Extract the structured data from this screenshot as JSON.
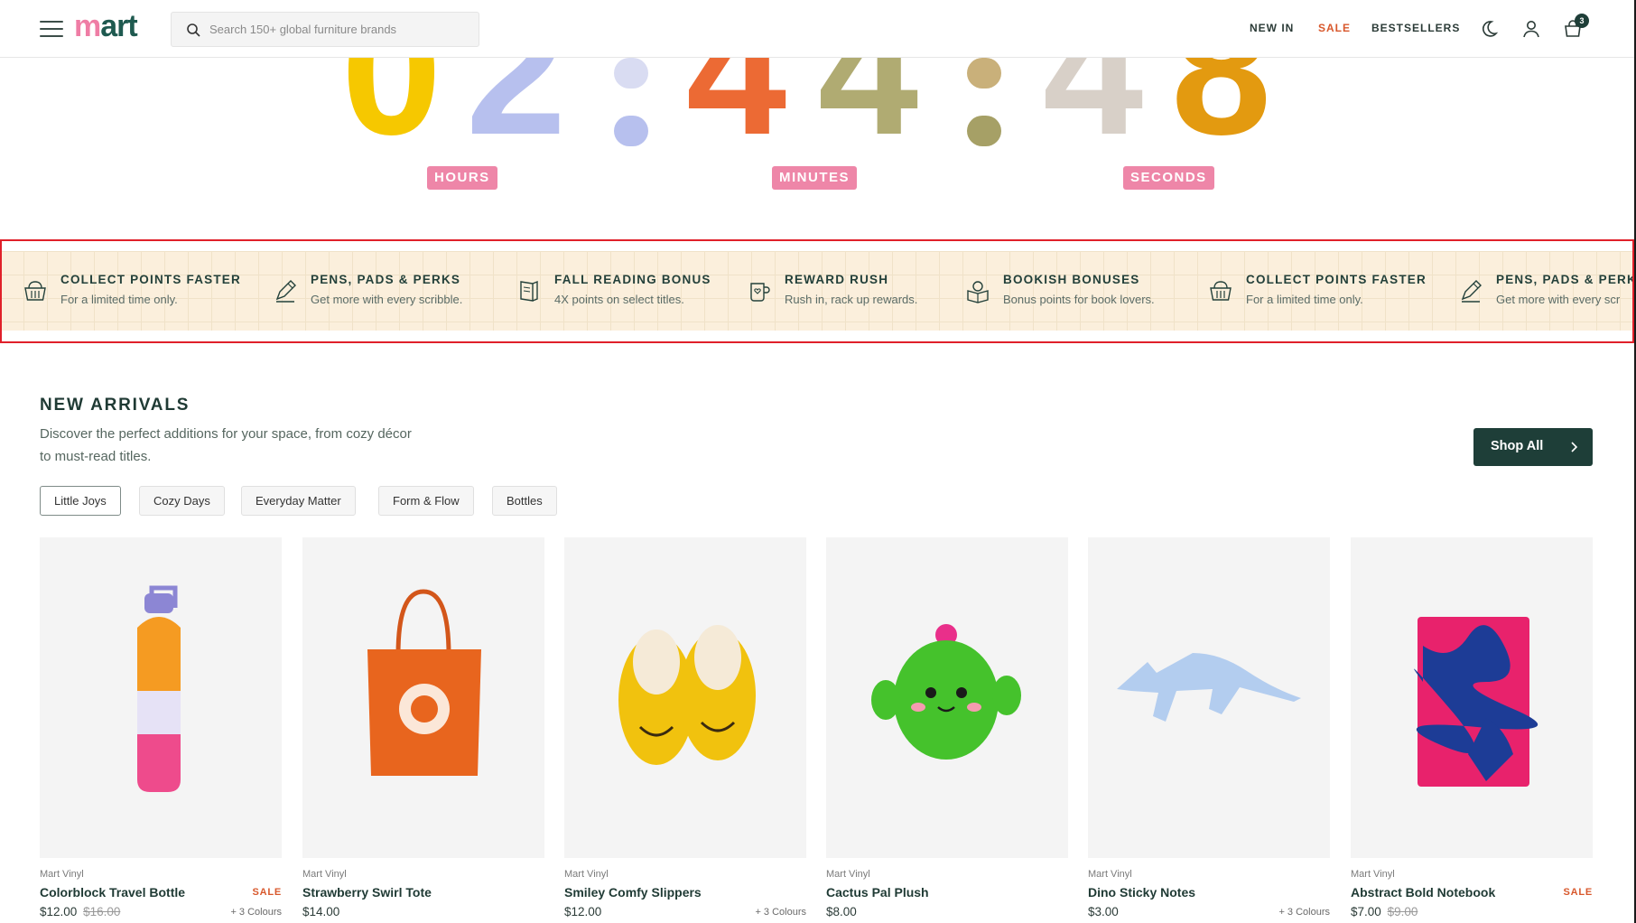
{
  "header": {
    "logo": {
      "part1": "m",
      "part2": "art"
    },
    "search": {
      "placeholder": "Search 150+ global furniture brands",
      "value": ""
    },
    "nav": [
      "NEW IN",
      "SALE",
      "BESTSELLERS"
    ],
    "cart_count": "3",
    "accent_sale": "#d8582c"
  },
  "countdown": {
    "digits": [
      "0",
      "2",
      "4",
      "4",
      "4",
      "8"
    ],
    "labels": {
      "hours": "HOURS",
      "minutes": "MINUTES",
      "seconds": "SECONDS"
    }
  },
  "promo": [
    {
      "icon": "basket-icon",
      "title": "COLLECT POINTS FASTER",
      "subtitle": "For a limited time only."
    },
    {
      "icon": "pencil-icon",
      "title": "PENS, PADS & PERKS",
      "subtitle": "Get more with every scribble."
    },
    {
      "icon": "book-icon",
      "title": "FALL READING BONUS",
      "subtitle": "4X points on select titles."
    },
    {
      "icon": "mug-icon",
      "title": "REWARD RUSH",
      "subtitle": "Rush in, rack up rewards."
    },
    {
      "icon": "reading-icon",
      "title": "BOOKISH BONUSES",
      "subtitle": "Bonus points for book lovers."
    },
    {
      "icon": "basket-icon",
      "title": "COLLECT POINTS FASTER",
      "subtitle": "For a limited time only."
    },
    {
      "icon": "pencil-icon",
      "title": "PENS, PADS & PERKS",
      "subtitle": "Get more with every scr"
    }
  ],
  "new_arrivals": {
    "title": "NEW ARRIVALS",
    "description": "Discover the perfect additions for your space, from cozy décor to must-read titles.",
    "shop_all": "Shop All",
    "filters": [
      "Little Joys",
      "Cozy Days",
      "Everyday Matter",
      "Form & Flow",
      "Bottles"
    ],
    "active_filter": "Little Joys",
    "products": [
      {
        "brand": "Mart Vinyl",
        "name": "Colorblock Travel Bottle",
        "price": "$12.00",
        "old_price": "$16.00",
        "badge": "SALE",
        "colours": "+ 3 Colours"
      },
      {
        "brand": "Mart Vinyl",
        "name": "Strawberry Swirl Tote",
        "price": "$14.00",
        "old_price": "",
        "badge": "",
        "colours": ""
      },
      {
        "brand": "Mart Vinyl",
        "name": "Smiley Comfy Slippers",
        "price": "$12.00",
        "old_price": "",
        "badge": "",
        "colours": "+ 3 Colours"
      },
      {
        "brand": "Mart Vinyl",
        "name": "Cactus Pal Plush",
        "price": "$8.00",
        "old_price": "",
        "badge": "",
        "colours": ""
      },
      {
        "brand": "Mart Vinyl",
        "name": "Dino Sticky Notes",
        "price": "$3.00",
        "old_price": "",
        "badge": "",
        "colours": "+ 3 Colours"
      },
      {
        "brand": "Mart Vinyl",
        "name": "Abstract Bold Notebook",
        "price": "$7.00",
        "old_price": "$9.00",
        "badge": "SALE",
        "colours": ""
      }
    ]
  }
}
